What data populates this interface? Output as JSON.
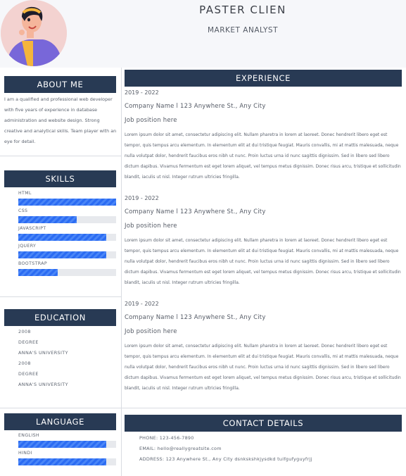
{
  "header": {
    "name": "PASTER CLIEN",
    "title": "MARKET ANALYST"
  },
  "about": {
    "heading": "ABOUT ME",
    "text": "I am a qualified and professional web developer with five years of experience in database administration and website design. Strong creative and analytical skills. Team player with an eye for detail."
  },
  "skills": {
    "heading": "SKILLS",
    "items": [
      {
        "label": "HTML",
        "level": 1.0
      },
      {
        "label": "CSS",
        "level": 0.6
      },
      {
        "label": "JAVASCRIPT",
        "level": 0.9
      },
      {
        "label": "JQUERY",
        "level": 0.9
      },
      {
        "label": "BOOTSTRAP",
        "level": 0.4
      }
    ]
  },
  "education": {
    "heading": "EDUCATION",
    "lines": [
      "2008",
      "DEGREE",
      "ANNA'S UNIVERSITY",
      "2008",
      "DEGREE",
      "ANNA'S UNIVERSITY"
    ]
  },
  "language": {
    "heading": "LANGUAGE",
    "items": [
      {
        "label": "ENGLISH",
        "level": 0.9
      },
      {
        "label": "HINDI",
        "level": 0.9
      }
    ]
  },
  "experience": {
    "heading": "EXPERIENCE",
    "entries": [
      {
        "date": "2019 - 2022",
        "company": "Company Name l 123 Anywhere St., Any City",
        "job": "Job position here",
        "desc": "Lorem ipsum dolor sit amet, consectetur adipiscing elit. Nullam pharetra in lorem at laoreet. Donec hendrerit libero eget est tempor, quis tempus arcu elementum. In elementum elit at dui tristique feugiat. Mauris convallis, mi at mattis malesuada, neque nulla volutpat dolor, hendrerit faucibus eros nibh ut nunc. Proin luctus urna id nunc sagittis dignissim. Sed in libero sed libero dictum dapibus. Vivamus fermentum est eget lorem aliquet, vel tempus metus dignissim. Donec risus arcu, tristique et sollicitudin blandit, iaculis ut nisl. Integer rutrum ultricies fringilla."
      },
      {
        "date": "2019 - 2022",
        "company": "Company Name l 123 Anywhere St., Any City",
        "job": "Job position here",
        "desc": "Lorem ipsum dolor sit amet, consectetur adipiscing elit. Nullam pharetra in lorem at laoreet. Donec hendrerit libero eget est tempor, quis tempus arcu elementum. In elementum elit at dui tristique feugiat. Mauris convallis, mi at mattis malesuada, neque nulla volutpat dolor, hendrerit faucibus eros nibh ut nunc. Proin luctus urna id nunc sagittis dignissim. Sed in libero sed libero dictum dapibus. Vivamus fermentum est eget lorem aliquet, vel tempus metus dignissim. Donec risus arcu, tristique et sollicitudin blandit, iaculis ut nisl. Integer rutrum ultricies fringilla."
      },
      {
        "date": "2019 - 2022",
        "company": "Company Name l 123 Anywhere St., Any City",
        "job": "Job position here",
        "desc": "Lorem ipsum dolor sit amet, consectetur adipiscing elit. Nullam pharetra in lorem at laoreet. Donec hendrerit libero eget est tempor, quis tempus arcu elementum. In elementum elit at dui tristique feugiat. Mauris convallis, mi at mattis malesuada, neque nulla volutpat dolor, hendrerit faucibus eros nibh ut nunc. Proin luctus urna id nunc sagittis dignissim. Sed in libero sed libero dictum dapibus. Vivamus fermentum est eget lorem aliquet, vel tempus metus dignissim. Donec risus arcu, tristique et sollicitudin blandit, iaculis ut nisl. Integer rutrum ultricies fringilla."
      }
    ]
  },
  "contact": {
    "heading": "CONTACT DETAILS",
    "phone": "PHONE: 123-456-7890",
    "email": "EMAIL: hello@reallygreatsite.com",
    "address": "ADDRESS: 123 Anywhere St., Any City dsnkskshkjysdkd tuifgufyguyfrjj"
  },
  "colors": {
    "accent": "#283a54",
    "bar": "#2c6cf2",
    "track": "#e7e9ed",
    "header_bg": "#f6f7fa"
  }
}
